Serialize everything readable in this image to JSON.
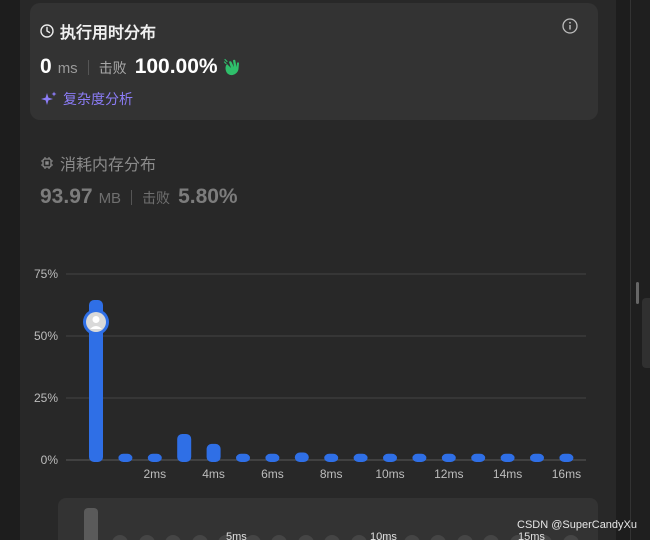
{
  "runtime": {
    "title": "执行用时分布",
    "value": "0",
    "unit": "ms",
    "beat_label": "击败",
    "beat_percent": "100.00%",
    "complexity_label": "复杂度分析"
  },
  "memory": {
    "title": "消耗内存分布",
    "value": "93.97",
    "unit": "MB",
    "beat_label": "击败",
    "beat_percent": "5.80%"
  },
  "colors": {
    "bar": "#2f6fe6",
    "accent_purple": "#8b7cf6",
    "clap_green": "#2fbf6b"
  },
  "chart_data": {
    "type": "bar",
    "ylim": [
      0,
      75
    ],
    "yticks": [
      "0%",
      "25%",
      "50%",
      "75%"
    ],
    "ytick_values": [
      0,
      25,
      50,
      75
    ],
    "x": [
      0,
      1,
      2,
      3,
      4,
      5,
      6,
      7,
      8,
      9,
      10,
      11,
      12,
      13,
      14,
      15,
      16
    ],
    "values": [
      64.5,
      2.5,
      2.5,
      10.5,
      6.5,
      2.5,
      2.5,
      3,
      2.5,
      2.5,
      2.5,
      2.5,
      2.5,
      2.5,
      2.5,
      2.5,
      2.5
    ],
    "xtick_labels": [
      "2ms",
      "4ms",
      "6ms",
      "8ms",
      "10ms",
      "12ms",
      "14ms",
      "16ms"
    ],
    "xtick_positions": [
      2,
      4,
      6,
      8,
      10,
      12,
      14,
      16
    ],
    "marker_index": 0,
    "grid": true
  },
  "mini_chart": {
    "labels": [
      "5ms",
      "10ms",
      "15ms"
    ]
  },
  "watermark": "CSDN @SuperCandyXu"
}
